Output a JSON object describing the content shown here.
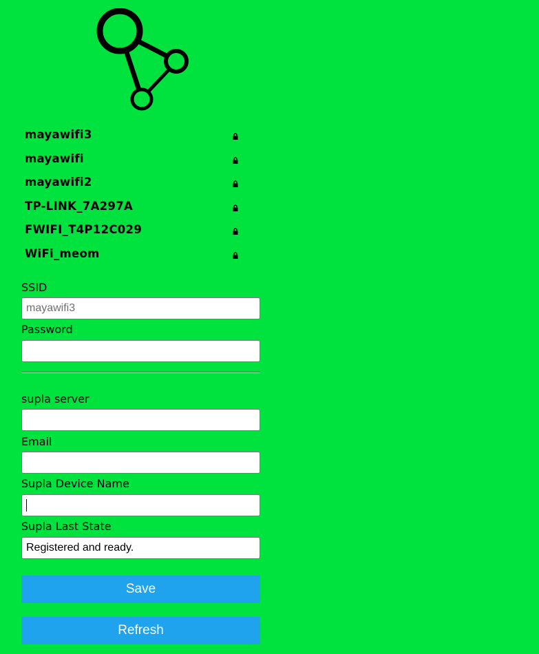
{
  "logo": {
    "icon": "share-network-icon",
    "color": "#000000"
  },
  "networks": [
    {
      "ssid": "mayawifi3",
      "secured": true
    },
    {
      "ssid": "mayawifi",
      "secured": true
    },
    {
      "ssid": "mayawifi2",
      "secured": true
    },
    {
      "ssid": "TP-LINK_7A297A",
      "secured": true
    },
    {
      "ssid": "FWIFI_T4P12C029",
      "secured": true
    },
    {
      "ssid": "WiFi_meom",
      "secured": true
    }
  ],
  "form": {
    "ssid": {
      "label": "SSID",
      "value": "",
      "placeholder": "mayawifi3"
    },
    "password": {
      "label": "Password",
      "value": ""
    },
    "server": {
      "label": "supla server",
      "value": ""
    },
    "email": {
      "label": "Email",
      "value": ""
    },
    "device_name": {
      "label": "Supla Device Name",
      "value": ""
    },
    "last_state": {
      "label": "Supla Last State",
      "value": "Registered and ready."
    }
  },
  "buttons": {
    "save": "Save",
    "refresh": "Refresh"
  },
  "colors": {
    "background": "#00e23d",
    "button": "#1fa3ec",
    "button_text": "#ffffff"
  }
}
